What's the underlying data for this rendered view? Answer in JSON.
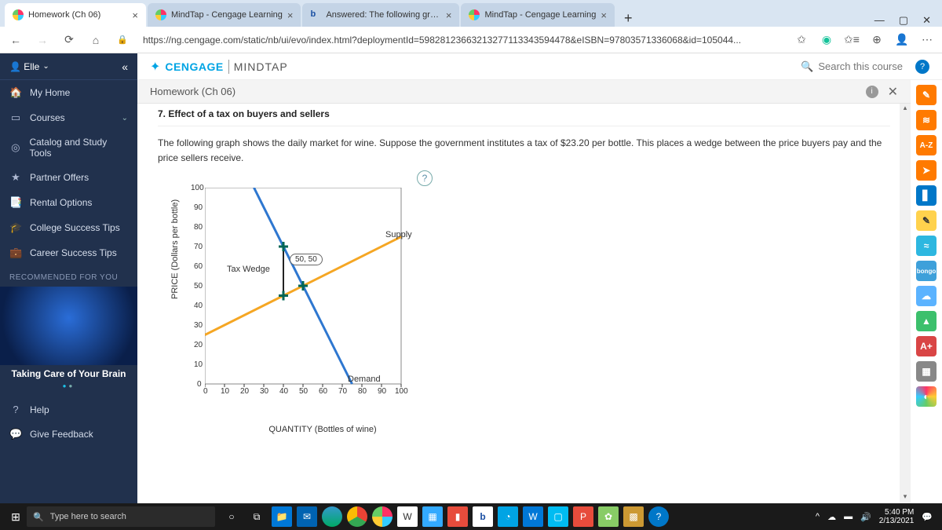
{
  "browser": {
    "tabs": [
      {
        "title": "Homework (Ch 06)"
      },
      {
        "title": "MindTap - Cengage Learning"
      },
      {
        "title": "Answered: The following graph s"
      },
      {
        "title": "MindTap - Cengage Learning"
      }
    ],
    "url": "https://ng.cengage.com/static/nb/ui/evo/index.html?deploymentId=59828123663213277113343594478&eISBN=97803571336068&id=105044...",
    "window_controls": {
      "min": "—",
      "max": "▢",
      "close": "✕"
    }
  },
  "header": {
    "brand_left": "CENGAGE",
    "brand_right": "MINDTAP",
    "search_placeholder": "Search this course",
    "user_name": "Elle"
  },
  "breadcrumb": {
    "title": "Homework (Ch 06)"
  },
  "sidebar": {
    "items": [
      {
        "icon": "🏠",
        "label": "My Home"
      },
      {
        "icon": "▭",
        "label": "Courses",
        "chev": "⌄"
      },
      {
        "icon": "◎",
        "label": "Catalog and Study Tools"
      },
      {
        "icon": "★",
        "label": "Partner Offers"
      },
      {
        "icon": "📑",
        "label": "Rental Options"
      },
      {
        "icon": "🎓",
        "label": "College Success Tips"
      },
      {
        "icon": "💼",
        "label": "Career Success Tips"
      }
    ],
    "rec_label": "RECOMMENDED FOR YOU",
    "brain_title": "Taking Care of Your Brain",
    "help": {
      "icon": "?",
      "label": "Help"
    },
    "feedback": {
      "icon": "💬",
      "label": "Give Feedback"
    }
  },
  "question": {
    "title": "7. Effect of a tax on buyers and sellers",
    "text": "The following graph shows the daily market for wine. Suppose the government institutes a tax of $23.20 per bottle. This places a wedge between the price buyers pay and the price sellers receive."
  },
  "chart_data": {
    "type": "line",
    "xlabel": "QUANTITY (Bottles of wine)",
    "ylabel": "PRICE (Dollars per bottle)",
    "xlim": [
      0,
      100
    ],
    "ylim": [
      0,
      100
    ],
    "xticks": [
      0,
      10,
      20,
      30,
      40,
      50,
      60,
      70,
      80,
      90,
      100
    ],
    "yticks": [
      0,
      10,
      20,
      30,
      40,
      50,
      60,
      70,
      80,
      90,
      100
    ],
    "series": [
      {
        "name": "Supply",
        "color": "#f5a623",
        "points": [
          [
            0,
            25
          ],
          [
            100,
            75
          ]
        ]
      },
      {
        "name": "Demand",
        "color": "#2e77d0",
        "points": [
          [
            25,
            100
          ],
          [
            75,
            0
          ]
        ]
      }
    ],
    "wedge": {
      "label": "Tax Wedge",
      "x": 40,
      "y_top": 70,
      "y_bottom": 45,
      "tooltip": "50, 50"
    }
  },
  "rail": [
    {
      "bg": "#ff7a00",
      "txt": "✎"
    },
    {
      "bg": "#ff7a00",
      "txt": "≋"
    },
    {
      "bg": "#ff7a00",
      "txt": "A-Z"
    },
    {
      "bg": "#ff7a00",
      "txt": "➤"
    },
    {
      "bg": "#0077c8",
      "txt": "▋"
    },
    {
      "bg": "#ffd24d",
      "txt": "✎"
    },
    {
      "bg": "#2db7e0",
      "txt": "≈"
    },
    {
      "bg": "#3ea0da",
      "txt": "b",
      "label": "bongo"
    },
    {
      "bg": "#5bb3ff",
      "txt": "☁"
    },
    {
      "bg": "#3cc06c",
      "txt": "▲"
    },
    {
      "bg": "#d94545",
      "txt": "A+"
    },
    {
      "bg": "#888",
      "txt": "▦"
    },
    {
      "bg": "linear",
      "txt": "◐"
    }
  ],
  "taskbar": {
    "search_placeholder": "Type here to search",
    "time": "5:40 PM",
    "date": "2/13/2021"
  }
}
